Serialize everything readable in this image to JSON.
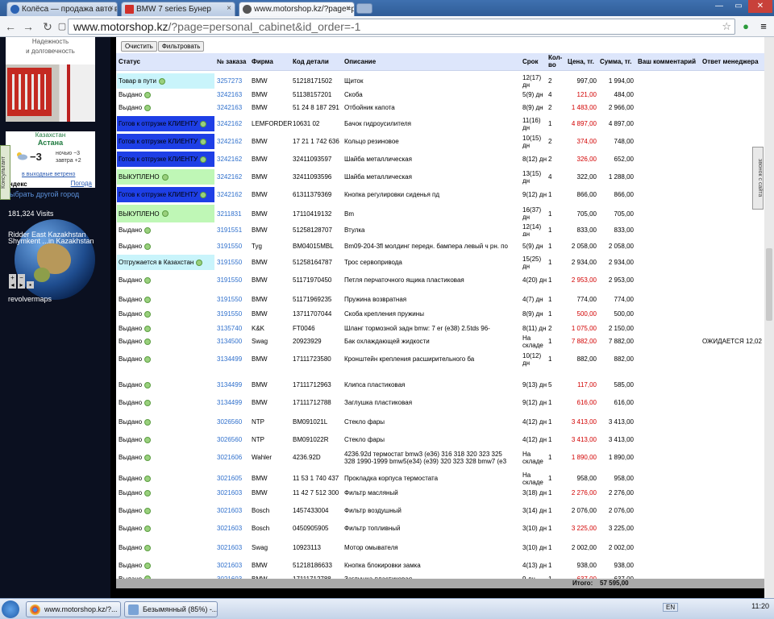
{
  "tabs": [
    {
      "label": "Колёса — продажа авто в",
      "active": false,
      "color": "#2b63b4"
    },
    {
      "label": "BMW 7 series Бунер",
      "active": false,
      "color": "#d0302a"
    },
    {
      "label": "www.motorshop.kz/?page=p",
      "active": true,
      "color": "#555555"
    }
  ],
  "address": {
    "host": "www.motorshop.kz",
    "path": "/?page=personal_cabinet&id_order=-1"
  },
  "left": {
    "ad_line1": "Надежность",
    "ad_line2": "и долговечность",
    "weather_country": "Казахстан",
    "weather_city": "Астана",
    "weather_temp": "−3",
    "weather_night": "ночью −3",
    "weather_tomorrow": "завтра +2",
    "weather_weekend": "в выходные ветрено",
    "weather_brand": "ндекс",
    "weather_link": "Погода",
    "consultant": "Консультант",
    "other_city": "ыбрать другой город",
    "visits": "181,324 Visits",
    "globe_label1": "Ridder East Kazakhstan",
    "globe_label2": "Shymkent ...in Kazakhstan",
    "revolvermaps": "revolvermaps",
    "callback": "звонок с сайта"
  },
  "buttons": {
    "clear": "Очистить",
    "filter": "Фильтровать"
  },
  "headers": {
    "status": "Статус",
    "order": "№ заказа",
    "brand": "Фирма",
    "code": "Код детали",
    "desc": "Описание",
    "term": "Срок",
    "qty": "Кол-во",
    "price": "Цена, тг.",
    "sum": "Сумма, тг.",
    "comment": "Ваш комментарий",
    "manager": "Ответ менеджера"
  },
  "rows": [
    {
      "status": "Товар в пути",
      "style": "cyan",
      "order": "3257273",
      "brand": "BMW",
      "code": "51218171502",
      "desc": "Щиток",
      "term": "12(17) дн",
      "qty": "2",
      "price": "997,00",
      "red": false,
      "sum": "1 994,00",
      "mgr": ""
    },
    {
      "status": "Выдано",
      "style": "",
      "order": "3242163",
      "brand": "BMW",
      "code": "51138157201",
      "desc": "Скоба",
      "term": "5(9) дн",
      "qty": "4",
      "price": "121,00",
      "red": true,
      "sum": "484,00",
      "mgr": ""
    },
    {
      "status": "Выдано",
      "style": "",
      "order": "3242163",
      "brand": "BMW",
      "code": "51 24 8 187 291",
      "desc": "Отбойник капота",
      "term": "8(9) дн",
      "qty": "2",
      "price": "1 483,00",
      "red": true,
      "sum": "2 966,00",
      "mgr": ""
    },
    {
      "status": "Готов к отгрузке КЛИЕНТУ",
      "style": "blue",
      "order": "3242162",
      "brand": "LEMFORDER",
      "code": "10631 02",
      "desc": "Бачок гидроусилителя",
      "term": "11(16) дн",
      "qty": "1",
      "price": "4 897,00",
      "red": true,
      "sum": "4 897,00",
      "mgr": ""
    },
    {
      "status": "Готов к отгрузке КЛИЕНТУ",
      "style": "blue",
      "order": "3242162",
      "brand": "BMW",
      "code": "17 21 1 742 636",
      "desc": "Кольцо резиновое",
      "term": "10(15) дн",
      "qty": "2",
      "price": "374,00",
      "red": true,
      "sum": "748,00",
      "mgr": ""
    },
    {
      "status": "Готов к отгрузке КЛИЕНТУ",
      "style": "blue",
      "order": "3242162",
      "brand": "BMW",
      "code": "32411093597",
      "desc": "Шайба металлическая",
      "term": "8(12) дн",
      "qty": "2",
      "price": "326,00",
      "red": true,
      "sum": "652,00",
      "mgr": ""
    },
    {
      "status": "ВЫКУПЛЕНО",
      "style": "green",
      "order": "3242162",
      "brand": "BMW",
      "code": "32411093596",
      "desc": "Шайба металлическая",
      "term": "13(15) дн",
      "qty": "4",
      "price": "322,00",
      "red": false,
      "sum": "1 288,00",
      "mgr": ""
    },
    {
      "status": "Готов к отгрузке КЛИЕНТУ",
      "style": "blue",
      "order": "3242162",
      "brand": "BMW",
      "code": "61311379369",
      "desc": "Кнопка регулировки сиденья пд",
      "term": "9(12) дн",
      "qty": "1",
      "price": "866,00",
      "red": false,
      "sum": "866,00",
      "mgr": ""
    },
    {
      "status": "ВЫКУПЛЕНО",
      "style": "green",
      "order": "3211831",
      "brand": "BMW",
      "code": "17110419132",
      "desc": "Вm",
      "term": "16(37) дн",
      "qty": "1",
      "price": "705,00",
      "red": false,
      "sum": "705,00",
      "mgr": ""
    },
    {
      "status": "Выдано",
      "style": "",
      "order": "3191551",
      "brand": "BMW",
      "code": "51258128707",
      "desc": "Втулка",
      "term": "12(14) дн",
      "qty": "1",
      "price": "833,00",
      "red": false,
      "sum": "833,00",
      "mgr": ""
    },
    {
      "status": "Выдано",
      "style": "",
      "order": "3191550",
      "brand": "Tyg",
      "code": "BM04015MBL",
      "desc": "Bm09-204-3fl молдинг передн. бампера левый ч рн. по",
      "term": "5(9) дн",
      "qty": "1",
      "price": "2 058,00",
      "red": false,
      "sum": "2 058,00",
      "mgr": ""
    },
    {
      "status": "Отгружается в Казахстан",
      "style": "cyan",
      "order": "3191550",
      "brand": "BMW",
      "code": "51258164787",
      "desc": "Трос сервопривода",
      "term": "15(25) дн",
      "qty": "1",
      "price": "2 934,00",
      "red": false,
      "sum": "2 934,00",
      "mgr": ""
    },
    {
      "status": "Выдано",
      "style": "",
      "order": "3191550",
      "brand": "BMW",
      "code": "51171970450",
      "desc": "Петля перчаточного ящика пластиковая",
      "term": "4(20) дн",
      "qty": "1",
      "price": "2 953,00",
      "red": true,
      "sum": "2 953,00",
      "mgr": ""
    },
    {
      "status": "Выдано",
      "style": "",
      "order": "3191550",
      "brand": "BMW",
      "code": "51171969235",
      "desc": "Пружина возвратная",
      "term": "4(7) дн",
      "qty": "1",
      "price": "774,00",
      "red": false,
      "sum": "774,00",
      "mgr": ""
    },
    {
      "status": "Выдано",
      "style": "",
      "order": "3191550",
      "brand": "BMW",
      "code": "13711707044",
      "desc": "Скоба крепления пружины",
      "term": "8(9) дн",
      "qty": "1",
      "price": "500,00",
      "red": true,
      "sum": "500,00",
      "mgr": ""
    },
    {
      "status": "Выдано",
      "style": "",
      "order": "3135740",
      "brand": "K&K",
      "code": "FT0046",
      "desc": "Шланг тормозной задн bmw: 7 er (e38) 2.5tds 96-",
      "term": "8(11) дн",
      "qty": "2",
      "price": "1 075,00",
      "red": true,
      "sum": "2 150,00",
      "mgr": ""
    },
    {
      "status": "Выдано",
      "style": "",
      "order": "3134500",
      "brand": "Swag",
      "code": "20923929",
      "desc": "Бак охлаждающей жидкости",
      "term": "На складе",
      "qty": "1",
      "price": "7 882,00",
      "red": true,
      "sum": "7 882,00",
      "mgr": "ОЖИДАЕТСЯ 12,02"
    },
    {
      "status": "Выдано",
      "style": "",
      "order": "3134499",
      "brand": "BMW",
      "code": "17111723580",
      "desc": "Кронштейн крепления расширительного ба",
      "term": "10(12) дн",
      "qty": "1",
      "price": "882,00",
      "red": false,
      "sum": "882,00",
      "mgr": ""
    },
    {
      "status": "Выдано",
      "style": "",
      "order": "3134499",
      "brand": "BMW",
      "code": "17111712963",
      "desc": "Клипса пластиковая",
      "term": "9(13) дн",
      "qty": "5",
      "price": "117,00",
      "red": true,
      "sum": "585,00",
      "mgr": ""
    },
    {
      "status": "Выдано",
      "style": "",
      "order": "3134499",
      "brand": "BMW",
      "code": "17111712788",
      "desc": "Заглушка пластиковая",
      "term": "9(12) дн",
      "qty": "1",
      "price": "616,00",
      "red": true,
      "sum": "616,00",
      "mgr": ""
    },
    {
      "status": "Выдано",
      "style": "",
      "order": "3026560",
      "brand": "NTP",
      "code": "BM091021L",
      "desc": "Стекло фары",
      "term": "4(12) дн",
      "qty": "1",
      "price": "3 413,00",
      "red": true,
      "sum": "3 413,00",
      "mgr": ""
    },
    {
      "status": "Выдано",
      "style": "",
      "order": "3026560",
      "brand": "NTP",
      "code": "BM091022R",
      "desc": "Стекло фары",
      "term": "4(12) дн",
      "qty": "1",
      "price": "3 413,00",
      "red": true,
      "sum": "3 413,00",
      "mgr": ""
    },
    {
      "status": "Выдано",
      "style": "",
      "order": "3021606",
      "brand": "Wahler",
      "code": "4236.92D",
      "desc": "4236.92d термостат bmw3 (e36) 316 318 320 323 325 328 1990-1999 bmw5(e34) (e39) 320 323 328 bmw7 (e3",
      "term": "На складе",
      "qty": "1",
      "price": "1 890,00",
      "red": true,
      "sum": "1 890,00",
      "mgr": ""
    },
    {
      "status": "Выдано",
      "style": "",
      "order": "3021605",
      "brand": "BMW",
      "code": "11 53 1 740 437",
      "desc": "Прокладка корпуса термостата",
      "term": "На складе",
      "qty": "1",
      "price": "958,00",
      "red": false,
      "sum": "958,00",
      "mgr": ""
    },
    {
      "status": "Выдано",
      "style": "",
      "order": "3021603",
      "brand": "BMW",
      "code": "11 42 7 512 300",
      "desc": "Фильтр масляный",
      "term": "3(18) дн",
      "qty": "1",
      "price": "2 276,00",
      "red": true,
      "sum": "2 276,00",
      "mgr": ""
    },
    {
      "status": "Выдано",
      "style": "",
      "order": "3021603",
      "brand": "Bosch",
      "code": "1457433004",
      "desc": "Фильтр воздушный",
      "term": "3(14) дн",
      "qty": "1",
      "price": "2 076,00",
      "red": false,
      "sum": "2 076,00",
      "mgr": ""
    },
    {
      "status": "Выдано",
      "style": "",
      "order": "3021603",
      "brand": "Bosch",
      "code": "0450905905",
      "desc": "Фильтр топливный",
      "term": "3(10) дн",
      "qty": "1",
      "price": "3 225,00",
      "red": true,
      "sum": "3 225,00",
      "mgr": ""
    },
    {
      "status": "Выдано",
      "style": "",
      "order": "3021603",
      "brand": "Swag",
      "code": "10923113",
      "desc": "Мотор омывателя",
      "term": "3(10) дн",
      "qty": "1",
      "price": "2 002,00",
      "red": false,
      "sum": "2 002,00",
      "mgr": ""
    },
    {
      "status": "Выдано",
      "style": "",
      "order": "3021603",
      "brand": "BMW",
      "code": "51218186633",
      "desc": "Кнопка блокировки замка",
      "term": "4(13) дн",
      "qty": "1",
      "price": "938,00",
      "red": false,
      "sum": "938,00",
      "mgr": ""
    },
    {
      "status": "Выдано",
      "style": "",
      "order": "3021603",
      "brand": "BMW",
      "code": "17111712788",
      "desc": "Заглушка пластиковая",
      "term": "9 дн",
      "qty": "1",
      "price": "637,00",
      "red": true,
      "sum": "637,00",
      "mgr": ""
    }
  ],
  "total": {
    "label": "Итого:",
    "value": "57 595,00"
  },
  "taskbar": {
    "task1": "www.motorshop.kz/?...",
    "task2": "Безымянный (85%) -...",
    "lang": "EN",
    "clock": "11:20"
  }
}
